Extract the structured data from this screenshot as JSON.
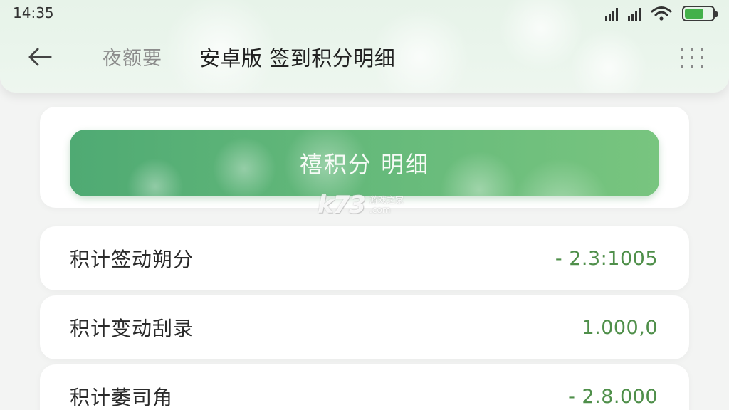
{
  "status_bar": {
    "time": "14:35"
  },
  "app_bar": {
    "back_label": "夜额要",
    "title": "安卓版 签到积分明细"
  },
  "primary_button": {
    "label": "禧积分 明细"
  },
  "rows": [
    {
      "label": "积计签动朔分",
      "value": "- 2.3:1005"
    },
    {
      "label": "积计变动刮录",
      "value": "1.000,0"
    },
    {
      "label": "积计萎司角",
      "value": "- 2.8.000"
    }
  ],
  "watermark": {
    "logo": "k73",
    "line1": "游戏之家",
    "line2": ".com"
  },
  "colors": {
    "accent_green": "#63b87a",
    "value_green": "#4f8f4a",
    "battery_green": "#43b04a"
  },
  "icons": {
    "back": "arrow-left-icon",
    "more": "grid-dots-icon",
    "signal": "signal-icon",
    "wifi": "wifi-icon",
    "battery": "battery-icon"
  }
}
